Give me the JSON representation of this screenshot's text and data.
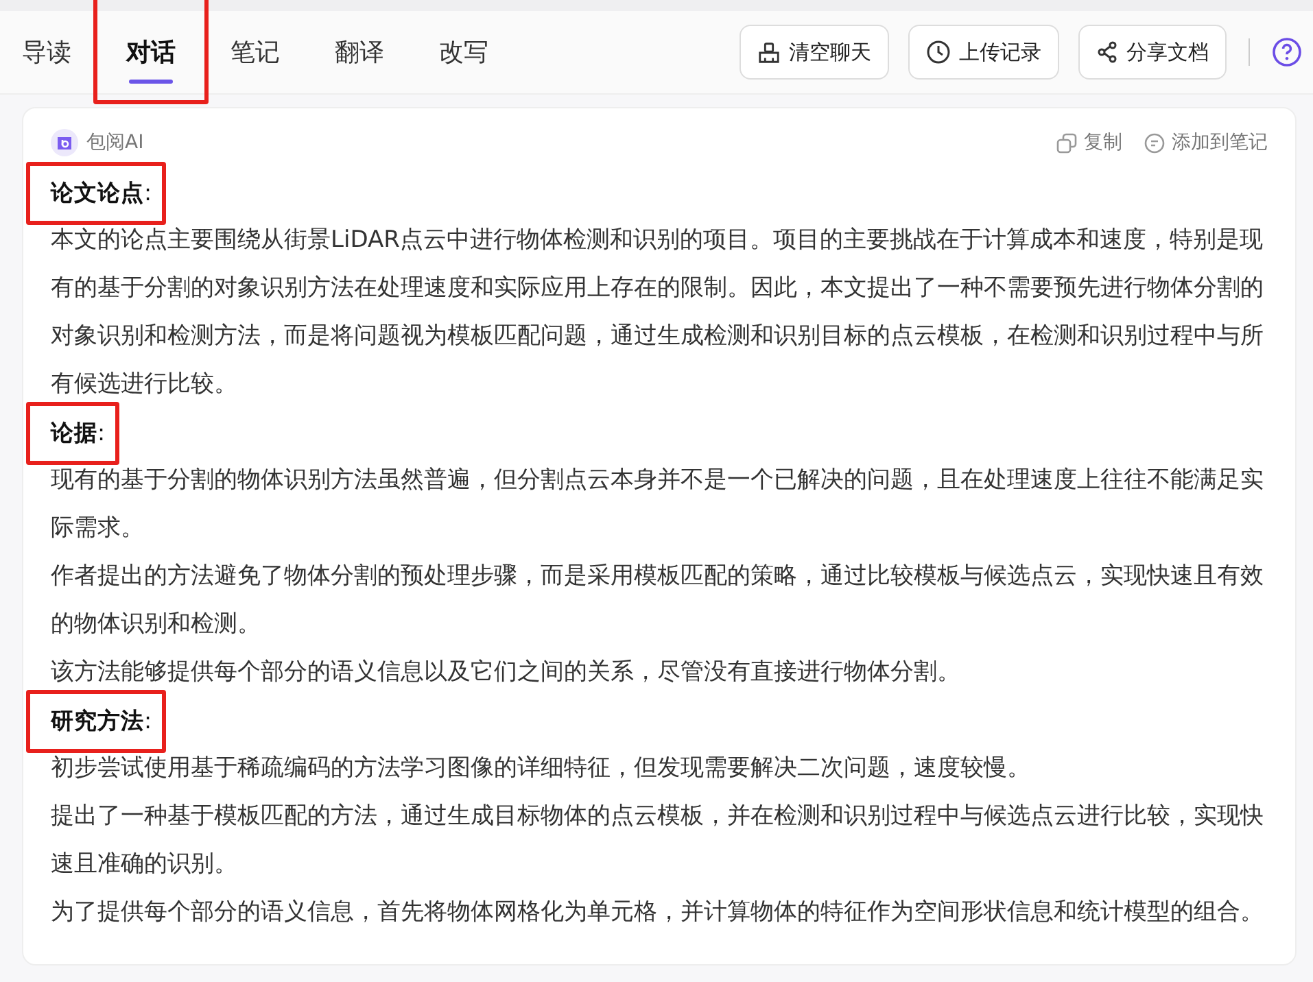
{
  "tabs": [
    {
      "label": "导读",
      "selected": false,
      "highlighted": false
    },
    {
      "label": "对话",
      "selected": true,
      "highlighted": true
    },
    {
      "label": "笔记",
      "selected": false,
      "highlighted": false
    },
    {
      "label": "翻译",
      "selected": false,
      "highlighted": false
    },
    {
      "label": "改写",
      "selected": false,
      "highlighted": false
    }
  ],
  "actions": [
    {
      "kind": "clear",
      "label": "清空聊天"
    },
    {
      "kind": "history",
      "label": "上传记录"
    },
    {
      "kind": "share",
      "label": "分享文档"
    }
  ],
  "message": {
    "sender": "包阅AI",
    "tools": [
      {
        "kind": "copy",
        "label": "复制"
      },
      {
        "kind": "note",
        "label": "添加到笔记"
      }
    ],
    "sections": [
      {
        "heading": "**论文论点**:",
        "highlighted": true,
        "paragraphs": [
          "本文的论点主要围绕从街景LiDAR点云中进行物体检测和识别的项目。项目的主要挑战在于计算成本和速度，特别是现有的基于分割的对象识别方法在处理速度和实际应用上存在的限制。因此，本文提出了一种不需要预先进行物体分割的对象识别和检测方法，而是将问题视为模板匹配问题，通过生成检测和识别目标的点云模板，在检测和识别过程中与所有候选进行比较。"
        ]
      },
      {
        "heading": "**论据**:",
        "highlighted": true,
        "paragraphs": [
          "现有的基于分割的物体识别方法虽然普遍，但分割点云本身并不是一个已解决的问题，且在处理速度上往往不能满足实际需求。",
          "作者提出的方法避免了物体分割的预处理步骤，而是采用模板匹配的策略，通过比较模板与候选点云，实现快速且有效的物体识别和检测。",
          "该方法能够提供每个部分的语义信息以及它们之间的关系，尽管没有直接进行物体分割。"
        ]
      },
      {
        "heading": "**研究方法**:",
        "highlighted": true,
        "paragraphs": [
          "初步尝试使用基于稀疏编码的方法学习图像的详细特征，但发现需要解决二次问题，速度较慢。",
          "提出了一种基于模板匹配的方法，通过生成目标物体的点云模板，并在检测和识别过程中与候选点云进行比较，实现快速且准确的识别。",
          "为了提供每个部分的语义信息，首先将物体网格化为单元格，并计算物体的特征作为空间形状信息和统计模型的组合。"
        ]
      }
    ]
  }
}
